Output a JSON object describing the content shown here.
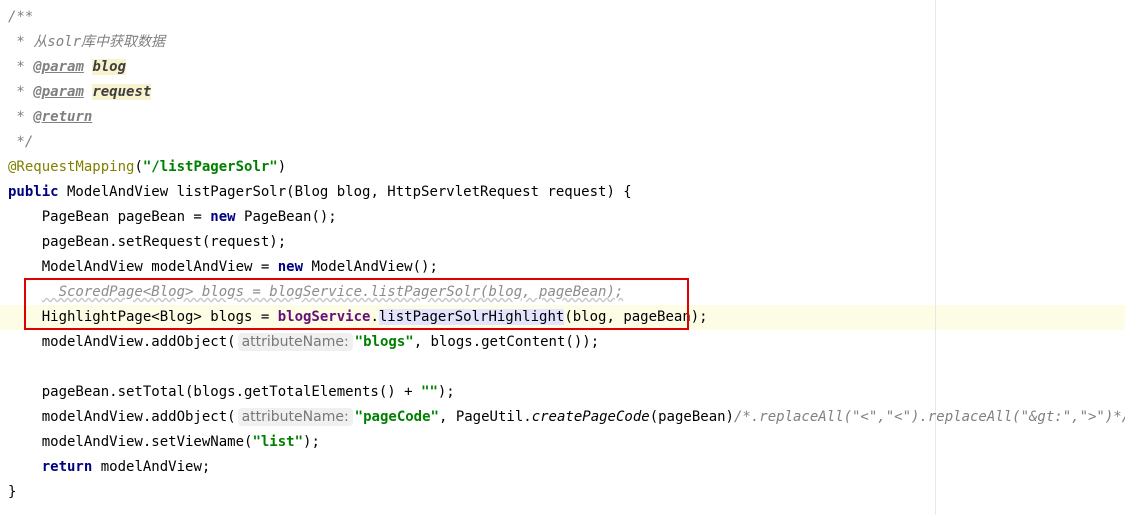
{
  "javadoc": {
    "open": "/**",
    "desc_prefix": " * ",
    "desc_text": "从solr库中获取数据",
    "param1_prefix": " * ",
    "param_tag": "@param",
    "param1_name": "blog",
    "param2_prefix": " * ",
    "param2_name": "request",
    "return_prefix": " * ",
    "return_tag": "@return",
    "close": " */"
  },
  "annotation": {
    "name": "@RequestMapping",
    "open_paren": "(",
    "value": "\"/listPagerSolr\"",
    "close_paren": ")"
  },
  "signature": {
    "kw_public": "public",
    "rest": " ModelAndView listPagerSolr(Blog blog, HttpServletRequest request) {"
  },
  "body": {
    "l1_a": "    PageBean pageBean = ",
    "l1_kw": "new",
    "l1_b": " PageBean();",
    "l2": "    pageBean.setRequest(request);",
    "l3_a": "    ModelAndView modelAndView = ",
    "l3_kw": "new",
    "l3_b": " ModelAndView();",
    "l4_indent": "    ",
    "l4_comment": "  ScoredPage<Blog> blogs = blogService.listPagerSolr(blog, pageBean);",
    "l5_a": "    HighlightPage<Blog> blogs = ",
    "l5_field": "blogService",
    "l5_dot": ".",
    "l5_method": "listPagerSolrHighlight",
    "l5_b": "(blog, pageBean);",
    "l6_a": "    modelAndView.addObject(",
    "l6_hint": "attributeName:",
    "l6_str": "\"blogs\"",
    "l6_b": ", blogs.getContent());",
    "l8_a": "    pageBean.setTotal(blogs.getTotalElements() + ",
    "l8_str": "\"\"",
    "l8_b": ");",
    "l9_a": "    modelAndView.addObject(",
    "l9_hint": "attributeName:",
    "l9_str": "\"pageCode\"",
    "l9_b": ", PageUtil.",
    "l9_method": "createPageCode",
    "l9_c": "(pageBean)",
    "l9_comment": "/*.replaceAll(\"<\",\"<\").replaceAll(\"&gt:\",\">\")*/",
    "l9_d": ");",
    "l10_a": "    modelAndView.setViewName(",
    "l10_str": "\"list\"",
    "l10_b": ");",
    "l11_indent": "    ",
    "l11_kw": "return",
    "l11_b": " modelAndView;",
    "close": "}"
  }
}
